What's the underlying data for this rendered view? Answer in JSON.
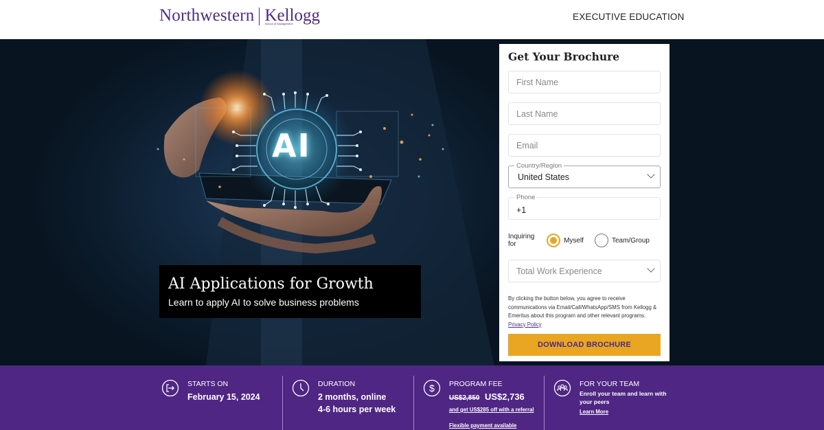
{
  "header": {
    "logo_primary": "Northwestern",
    "logo_secondary": "Kellogg",
    "logo_sub": "School of Management",
    "nav_label": "EXECUTIVE EDUCATION"
  },
  "hero": {
    "image_alt": "Hand holding smartphone with glowing AI circuit hologram",
    "image_overlay_text": "AI",
    "title": "AI Applications for Growth",
    "subtitle": "Learn to apply AI to solve business problems"
  },
  "form": {
    "title": "Get Your Brochure",
    "first_name": {
      "placeholder": "First Name",
      "value": ""
    },
    "last_name": {
      "placeholder": "Last Name",
      "value": ""
    },
    "email": {
      "placeholder": "Email",
      "value": ""
    },
    "country": {
      "label": "Country/Region",
      "value": "United States"
    },
    "phone": {
      "label": "Phone",
      "value": "+1"
    },
    "inquiring_label": "Inquiring for",
    "inquiring_options": [
      {
        "label": "Myself",
        "checked": true
      },
      {
        "label": "Team/Group",
        "checked": false
      }
    ],
    "work_experience": {
      "placeholder": "Total Work Experience"
    },
    "consent_text": "By clicking the button below, you agree to receive communications via Email/Call/WhatsApp/SMS from Kellogg & Emeritus about this program and other relevant programs.",
    "privacy_link": "Privacy Policy",
    "submit_label": "DOWNLOAD BROCHURE"
  },
  "stats": {
    "starts": {
      "icon": "enter-icon",
      "heading": "STARTS ON",
      "value": "February 15, 2024"
    },
    "duration": {
      "icon": "clock-icon",
      "heading": "DURATION",
      "value_line1": "2 months, online",
      "value_line2": "4-6 hours per week"
    },
    "fee": {
      "icon": "dollar-icon",
      "heading": "PROGRAM FEE",
      "original": "US$2,850",
      "current": "US$2,736",
      "referral_link": "and get US$285 off with a referral",
      "payment_link": "Flexible payment available"
    },
    "team": {
      "icon": "team-icon",
      "heading": "FOR YOUR TEAM",
      "text": "Enroll your team and learn with your peers",
      "link": "Learn More"
    }
  },
  "colors": {
    "brand_purple": "#4f2683",
    "accent_gold": "#e8a623",
    "hero_dark": "#0c1c2c"
  }
}
